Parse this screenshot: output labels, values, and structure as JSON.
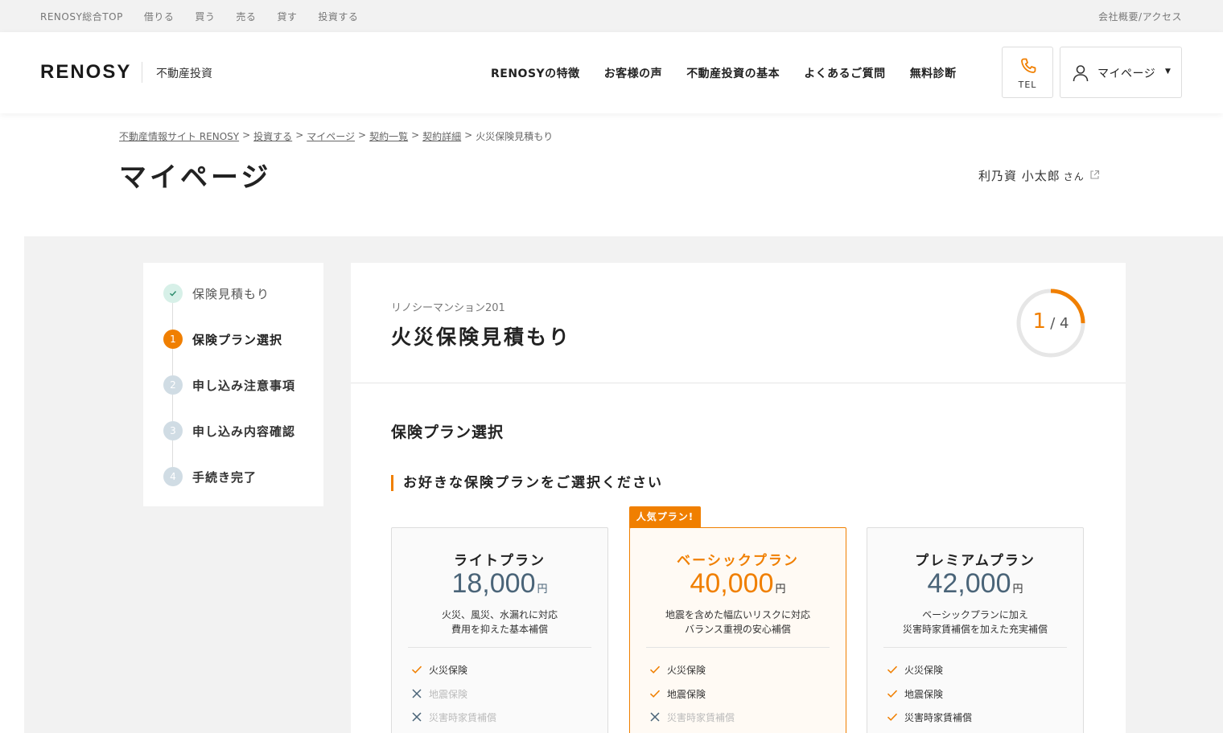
{
  "topbar": {
    "links": [
      "RENOSY総合TOP",
      "借りる",
      "買う",
      "売る",
      "貸す",
      "投資する"
    ],
    "right_link": "会社概要/アクセス"
  },
  "header": {
    "logo": "RENOSY",
    "logo_sub": "不動産投資",
    "nav": [
      "RENOSYの特徴",
      "お客様の声",
      "不動産投資の基本",
      "よくあるご質問",
      "無料診断"
    ],
    "tel_label": "TEL",
    "mypage_label": "マイページ",
    "accent": "#f07f00"
  },
  "breadcrumb": {
    "items": [
      "不動産情報サイト RENOSY",
      "投資する",
      "マイページ",
      "契約一覧",
      "契約詳細"
    ],
    "current": "火災保険見積もり",
    "separator": ">"
  },
  "page": {
    "title": "マイページ",
    "user_name": "利乃資 小太郎",
    "user_suffix": "さん"
  },
  "steps": [
    {
      "num": "",
      "label": "保険見積もり",
      "state": "done"
    },
    {
      "num": "1",
      "label": "保険プラン選択",
      "state": "active"
    },
    {
      "num": "2",
      "label": "申し込み注意事項",
      "state": "todo"
    },
    {
      "num": "3",
      "label": "申し込み内容確認",
      "state": "todo"
    },
    {
      "num": "4",
      "label": "手続き完了",
      "state": "todo"
    }
  ],
  "panel": {
    "property": "リノシーマンション201",
    "title": "火災保険見積もり",
    "progress_current": "1",
    "progress_total": "/ 4",
    "progress_fraction": 0.25,
    "section_title": "保険プラン選択",
    "sub_title": "お好きな保険プランをご選択ください"
  },
  "badge": "人気プラン!",
  "plans": [
    {
      "name": "ライトプラン",
      "price": "18,000",
      "unit": "円",
      "desc1": "火災、風災、水漏れに対応",
      "desc2": "費用を抑えた基本補償",
      "features": [
        {
          "label": "火災保険",
          "included": true
        },
        {
          "label": "地震保険",
          "included": false
        },
        {
          "label": "災害時家賃補償",
          "included": false
        }
      ]
    },
    {
      "name": "ベーシックプラン",
      "price": "40,000",
      "unit": "円",
      "desc1": "地震を含めた幅広いリスクに対応",
      "desc2": "バランス重視の安心補償",
      "features": [
        {
          "label": "火災保険",
          "included": true
        },
        {
          "label": "地震保険",
          "included": true
        },
        {
          "label": "災害時家賃補償",
          "included": false
        }
      ]
    },
    {
      "name": "プレミアムプラン",
      "price": "42,000",
      "unit": "円",
      "desc1": "ベーシックプランに加え",
      "desc2": "災害時家賃補償を加えた充実補償",
      "features": [
        {
          "label": "火災保険",
          "included": true
        },
        {
          "label": "地震保険",
          "included": true
        },
        {
          "label": "災害時家賃補償",
          "included": true
        }
      ]
    }
  ]
}
